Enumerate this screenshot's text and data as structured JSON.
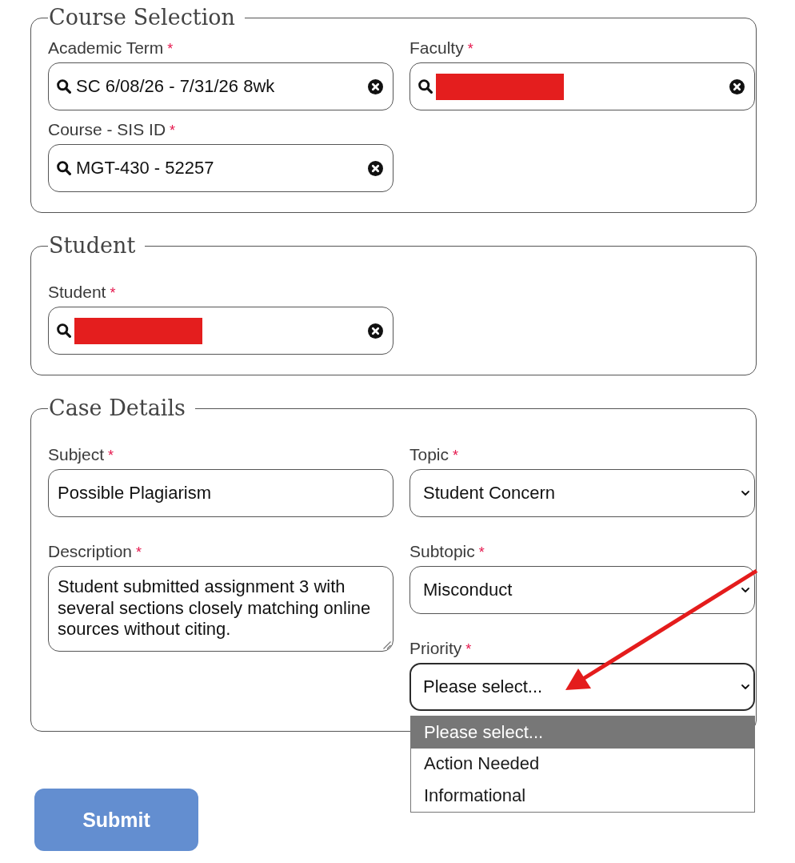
{
  "sections": [
    {
      "legend": "Course Selection",
      "columns": [
        [
          {
            "kind": "search",
            "label": "Academic Term",
            "required_mark": "*",
            "value": "SC 6/08/26 - 7/31/26 8wk",
            "redacted": false
          },
          {
            "kind": "search",
            "label": "Course - SIS ID",
            "required_mark": "*",
            "value": "MGT-430 - 52257",
            "redacted": false
          }
        ],
        [
          {
            "kind": "search",
            "label": "Faculty",
            "required_mark": "*",
            "redacted": true
          }
        ]
      ]
    },
    {
      "legend": "Student",
      "columns": [
        [
          {
            "kind": "search",
            "label": "Student",
            "required_mark": "*",
            "redacted": true
          }
        ]
      ]
    },
    {
      "legend": "Case Details",
      "columns": [
        [
          {
            "kind": "text",
            "label": "Subject",
            "required_mark": "*",
            "value": "Possible Plagiarism"
          },
          {
            "kind": "textarea",
            "label": "Description",
            "required_mark": "*",
            "value": "Student submitted assignment 3 with several sections closely matching online sources without citing."
          }
        ],
        [
          {
            "kind": "select",
            "label": "Topic",
            "required_mark": "*",
            "value": "Student Concern",
            "expanded": false,
            "pointed_by_arrow": false
          },
          {
            "kind": "select",
            "label": "Subtopic",
            "required_mark": "*",
            "value": "Misconduct",
            "expanded": false,
            "pointed_by_arrow": false
          },
          {
            "kind": "select",
            "label": "Priority",
            "required_mark": "*",
            "value": "Please select...",
            "expanded": true,
            "pointed_by_arrow": true,
            "options": [
              {
                "label": "Please select...",
                "selected": true
              },
              {
                "label": "Action Needed",
                "selected": false
              },
              {
                "label": "Informational",
                "selected": false
              }
            ]
          }
        ]
      ]
    }
  ],
  "submit_button": {
    "label": "Submit"
  }
}
